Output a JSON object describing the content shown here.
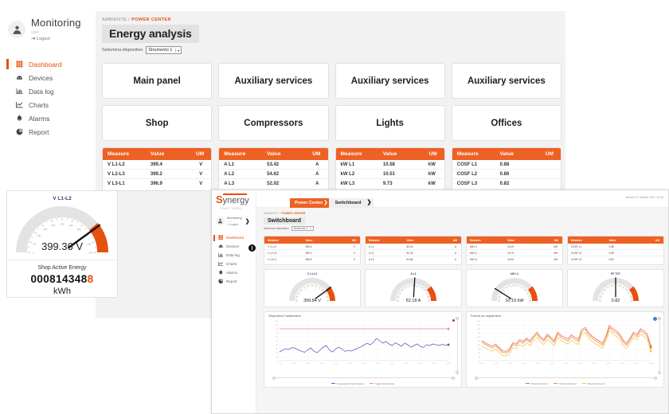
{
  "outer": {
    "brand": {
      "title": "Monitoring",
      "user": "user",
      "logout": "Logout"
    },
    "nav": [
      {
        "label": "Dashboard",
        "icon": "grid-icon",
        "active": true
      },
      {
        "label": "Devices",
        "icon": "devices-icon",
        "active": false
      },
      {
        "label": "Data log",
        "icon": "bar-chart-icon",
        "active": false
      },
      {
        "label": "Charts",
        "icon": "line-chart-icon",
        "active": false
      },
      {
        "label": "Alarms",
        "icon": "bell-icon",
        "active": false
      },
      {
        "label": "Report",
        "icon": "pie-chart-icon",
        "active": false
      }
    ],
    "breadcrumb_root": "AMBIENTE",
    "breadcrumb_sep": "/",
    "breadcrumb_current": "POWER CENTER",
    "page_title": "Energy analysis",
    "device_label": "Seleziona dispositivo",
    "device_value": "Strumento 1",
    "tiles": [
      "Main panel",
      "Auxiliary services",
      "Auxiliary services",
      "Auxiliary services",
      "Shop",
      "Compressors",
      "Lights",
      "Offices"
    ],
    "table_headers": [
      "Measure",
      "Value",
      "UM"
    ],
    "tables": [
      {
        "rows": [
          [
            "V L1-L2",
            "399.4",
            "V"
          ],
          [
            "V L2-L3",
            "399.2",
            "V"
          ],
          [
            "V L3-L1",
            "396.9",
            "V"
          ]
        ]
      },
      {
        "rows": [
          [
            "A L1",
            "53.42",
            "A"
          ],
          [
            "A L2",
            "54.62",
            "A"
          ],
          [
            "A L3",
            "52.02",
            "A"
          ]
        ]
      },
      {
        "rows": [
          [
            "kW L1",
            "10.58",
            "kW"
          ],
          [
            "kW L2",
            "10.51",
            "kW"
          ],
          [
            "kW L3",
            "9.73",
            "kW"
          ]
        ]
      },
      {
        "rows": [
          [
            "COSF L1",
            "0.88",
            ""
          ],
          [
            "COSF L2",
            "0.86",
            ""
          ],
          [
            "COSF L3",
            "0.82",
            ""
          ]
        ]
      }
    ],
    "gauge": {
      "title": "V L1-L2",
      "value_text": "399.36 V",
      "ticks": [
        "0",
        "50",
        "100",
        "150",
        "200",
        "250",
        "300",
        "350",
        "400",
        "450",
        "500"
      ],
      "percent": 80
    },
    "energy": {
      "label": "Shop  Active Energy",
      "digits": "0008143488",
      "last_digit": "8",
      "unit": "kWh"
    }
  },
  "inner": {
    "logo_s": "S",
    "logo_rest": "ynergy",
    "logo_sub": "POWER - ENERGY",
    "user": {
      "name": "Monitoring",
      "sub": "user",
      "logout": "Logout"
    },
    "nav": [
      {
        "label": "Dashboard",
        "icon": "grid-icon",
        "active": true
      },
      {
        "label": "Devices",
        "icon": "devices-icon",
        "active": false
      },
      {
        "label": "Data log",
        "icon": "bar-chart-icon",
        "active": false
      },
      {
        "label": "Charts",
        "icon": "line-chart-icon",
        "active": false
      },
      {
        "label": "Alarms",
        "icon": "bell-icon",
        "active": false
      },
      {
        "label": "Report",
        "icon": "pie-chart-icon",
        "active": false
      }
    ],
    "date": "Venerdì 22 Ottobre 2021, 10:05",
    "tab_active": "Power Center",
    "tab_next": "Switchboard",
    "breadcrumb_root": "AMBIENTE",
    "breadcrumb_sep": "/",
    "breadcrumb_current": "POWER CENTER",
    "page_title": "Switchboard",
    "device_label": "Seleziona dispositivo",
    "device_value": "Strumento 1",
    "table_headers": [
      "Measure",
      "Value",
      "UM"
    ],
    "tables": [
      {
        "rows": [
          [
            "V L1-L2",
            "399.4",
            "V"
          ],
          [
            "V L2-L3",
            "399.2",
            "V"
          ],
          [
            "V L3-L1",
            "396.9",
            "V"
          ]
        ]
      },
      {
        "rows": [
          [
            "A L1",
            "52.18",
            "A"
          ],
          [
            "A L2",
            "52.24",
            "A"
          ],
          [
            "A L3",
            "51.66",
            "A"
          ]
        ]
      },
      {
        "rows": [
          [
            "kW L1",
            "10.19",
            "kW"
          ],
          [
            "kW L2",
            "10.70",
            "kW"
          ],
          [
            "kW L3",
            "10.44",
            "kW"
          ]
        ]
      },
      {
        "rows": [
          [
            "COSF L1",
            "0.88",
            ""
          ],
          [
            "COSF L2",
            "0.85",
            ""
          ],
          [
            "COSF L3",
            "0.82",
            ""
          ]
        ]
      }
    ],
    "gauges": [
      {
        "title": "V L1-L2",
        "value_text": "399.84 V",
        "percent": 80
      },
      {
        "title": "A L1",
        "value_text": "52.18 A",
        "percent": 52
      },
      {
        "title": "kW L1",
        "value_text": "10.19 kW",
        "percent": 18
      },
      {
        "title": "PF TOT",
        "value_text": "0.82",
        "percent": 50
      }
    ],
    "colors": {
      "accent": "#E8500E",
      "table_header": "#EE6124",
      "chart_blue": "#5b5bc6",
      "chart_red": "#e8645a",
      "chart_orange": "#f2883c",
      "chart_yellow": "#f2c744"
    }
  },
  "chart_data": [
    {
      "type": "line",
      "title": "Temperatura Trasformatore",
      "xlabel": "",
      "ylabel": "",
      "ylim": [
        0,
        100
      ],
      "grid": true,
      "legend_position": "bottom",
      "x": [
        "10:00",
        "10:05",
        "10:10",
        "10:15",
        "10:20",
        "10:25",
        "10:30",
        "10:35",
        "10:40",
        "10:45",
        "10:50",
        "10:55",
        "11:00",
        "11:05",
        "11:10",
        "11:15",
        "11:20",
        "11:25",
        "11:30",
        "11:35",
        "11:40",
        "11:45",
        "11:50",
        "11:55",
        "12:00",
        "12:05",
        "12:10",
        "12:15",
        "12:20",
        "12:25",
        "12:30",
        "12:35",
        "12:40",
        "12:45",
        "12:50",
        "12:55",
        "13:00",
        "13:05",
        "13:10",
        "13:15",
        "13:20",
        "13:25",
        "13:30",
        "13:35",
        "13:40",
        "13:45",
        "13:50",
        "13:55",
        "14:00",
        "14:05"
      ],
      "series": [
        {
          "name": "Temperatura Trasformatore",
          "color": "#5b5bc6",
          "values": [
            22,
            26,
            30,
            28,
            33,
            31,
            27,
            24,
            21,
            27,
            32,
            24,
            20,
            27,
            34,
            38,
            26,
            22,
            30,
            34,
            29,
            23,
            26,
            24,
            28,
            31,
            35,
            39,
            44,
            40,
            46,
            56,
            50,
            44,
            48,
            42,
            38,
            45,
            41,
            36,
            44,
            40,
            34,
            38,
            42,
            36,
            33,
            40,
            38,
            42,
            40,
            38,
            41,
            39,
            40
          ]
        },
        {
          "name": "Soglia Temperatura",
          "color": "#f08a80",
          "values": [
            80,
            80,
            80,
            80,
            80,
            80,
            80,
            80,
            80,
            80,
            80,
            80,
            80,
            80,
            80,
            80,
            80,
            80,
            80,
            80,
            80,
            80,
            80,
            80,
            80,
            80,
            80,
            80,
            80,
            80,
            80,
            80,
            80,
            80,
            80,
            80,
            80,
            80,
            80,
            80,
            80,
            80,
            80,
            80,
            80,
            80,
            80,
            80,
            80,
            80,
            80,
            80,
            80,
            80,
            80
          ]
        }
      ]
    },
    {
      "type": "line",
      "title": "Potenze per singola linea",
      "xlabel": "",
      "ylabel": "",
      "ylim": [
        0,
        300
      ],
      "grid": true,
      "legend_position": "bottom",
      "x": [
        "10:00",
        "10:10",
        "10:20",
        "10:30",
        "10:40",
        "10:50",
        "11:00",
        "11:10",
        "11:20",
        "11:30",
        "11:40",
        "11:50",
        "12:00",
        "12:10",
        "12:20",
        "12:30",
        "12:40",
        "12:50",
        "13:00",
        "13:10",
        "13:20",
        "13:30",
        "13:40",
        "13:50",
        "14:00"
      ],
      "series": [
        {
          "name": "Potenza attiva L1",
          "color": "#e8645a",
          "values": [
            150,
            135,
            120,
            110,
            125,
            100,
            75,
            70,
            85,
            135,
            125,
            160,
            145,
            170,
            150,
            185,
            215,
            180,
            160,
            200,
            175,
            150,
            215,
            190,
            175,
            165,
            195,
            175,
            160,
            235,
            250,
            210,
            185,
            165,
            150,
            130,
            185,
            265,
            240,
            225,
            200,
            155,
            130,
            170,
            215,
            195,
            240,
            225,
            200,
            110
          ]
        },
        {
          "name": "Potenza attiva L2",
          "color": "#f2883c",
          "values": [
            140,
            122,
            108,
            95,
            112,
            88,
            62,
            58,
            72,
            122,
            112,
            148,
            132,
            158,
            136,
            172,
            200,
            166,
            146,
            186,
            162,
            136,
            200,
            176,
            160,
            150,
            180,
            160,
            146,
            220,
            236,
            196,
            170,
            150,
            136,
            116,
            170,
            250,
            224,
            208,
            184,
            140,
            116,
            156,
            200,
            180,
            224,
            208,
            184,
            96
          ]
        },
        {
          "name": "Potenza attiva L3",
          "color": "#f2c744",
          "values": [
            112,
            95,
            82,
            70,
            88,
            64,
            40,
            36,
            50,
            98,
            88,
            122,
            108,
            134,
            112,
            148,
            176,
            142,
            122,
            162,
            138,
            112,
            176,
            152,
            136,
            126,
            156,
            136,
            122,
            196,
            212,
            172,
            146,
            126,
            112,
            92,
            146,
            226,
            200,
            184,
            160,
            116,
            92,
            132,
            176,
            156,
            200,
            184,
            160,
            72
          ]
        }
      ]
    }
  ]
}
